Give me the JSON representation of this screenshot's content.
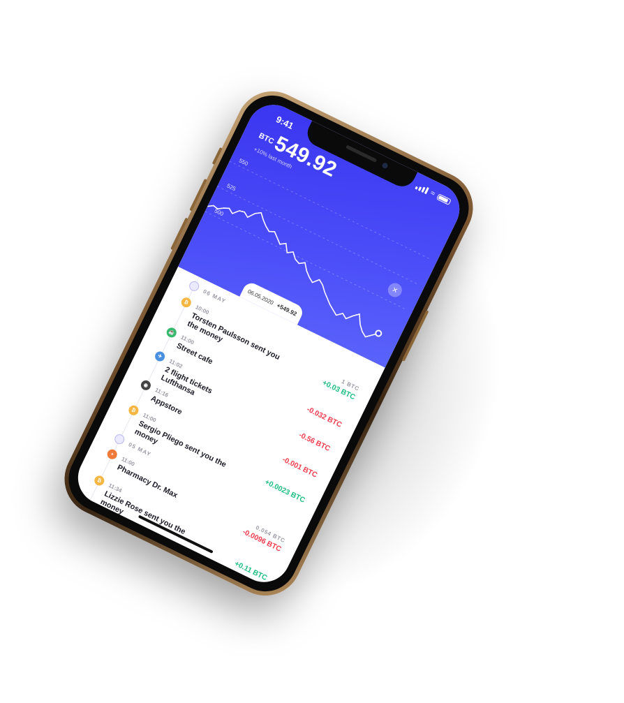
{
  "status_bar": {
    "time": "9:41"
  },
  "header": {
    "ticker": "BTC",
    "price": "549.92",
    "change": "+10% last month",
    "y_axis_labels": [
      "550",
      "525",
      "500"
    ],
    "close_icon": "close-icon"
  },
  "tooltip": {
    "date": "06.05.2020",
    "value": "+549.92"
  },
  "chart_line": {
    "series": "btc-price",
    "values": [
      505,
      508,
      507,
      510,
      512,
      509,
      514,
      515,
      512,
      518,
      521,
      516,
      512,
      509,
      511,
      507,
      503,
      506,
      499,
      502,
      497,
      495,
      498,
      492,
      488,
      485,
      490,
      487,
      482,
      478,
      474,
      471,
      468,
      472,
      469,
      474,
      478,
      470,
      465,
      462,
      466,
      470
    ]
  },
  "list": {
    "groups": [
      {
        "date": "06 MAY",
        "items": [
          {
            "time": "10:00",
            "title": "Torsten Paulsson sent you the money",
            "meta": "1 BTC",
            "amount": "+0.03 BTC",
            "color": "#1fbf83",
            "icon_color": "#f5b642",
            "icon": "coin-icon"
          },
          {
            "time": "11:00",
            "title": "Street cafe",
            "meta": "",
            "amount": "-0.032 BTC",
            "color": "#f03e4f",
            "icon_color": "#35b96b",
            "icon": "cafe-icon"
          },
          {
            "time": "11:02",
            "title": "2 flight tickets Lufthansa",
            "meta": "",
            "amount": "-0.56 BTC",
            "color": "#f03e4f",
            "icon_color": "#4a90e2",
            "icon": "plane-icon"
          },
          {
            "time": "11:16",
            "title": "Appstore",
            "meta": "",
            "amount": "-0.001 BTC",
            "color": "#f03e4f",
            "icon_color": "#444444",
            "icon": "apple-icon"
          },
          {
            "time": "11:00",
            "title": "Sergio Pliego sent you the money",
            "meta": "",
            "amount": "+0.0023 BTC",
            "color": "#1fbf83",
            "icon_color": "#f5b642",
            "icon": "coin-icon"
          }
        ]
      },
      {
        "date": "05 MAY",
        "items": [
          {
            "time": "11:00",
            "title": "Pharmacy Dr. Max",
            "meta": "0.054 BTC",
            "amount": "-0.0096 BTC",
            "color": "#f03e4f",
            "icon_color": "#f07a3a",
            "icon": "pharmacy-icon"
          },
          {
            "time": "11:34",
            "title": "Lizzie Rose sent you the money",
            "meta": "",
            "amount": "+0.11 BTC",
            "color": "#1fbf83",
            "icon_color": "#f5b642",
            "icon": "coin-icon"
          }
        ]
      }
    ]
  }
}
